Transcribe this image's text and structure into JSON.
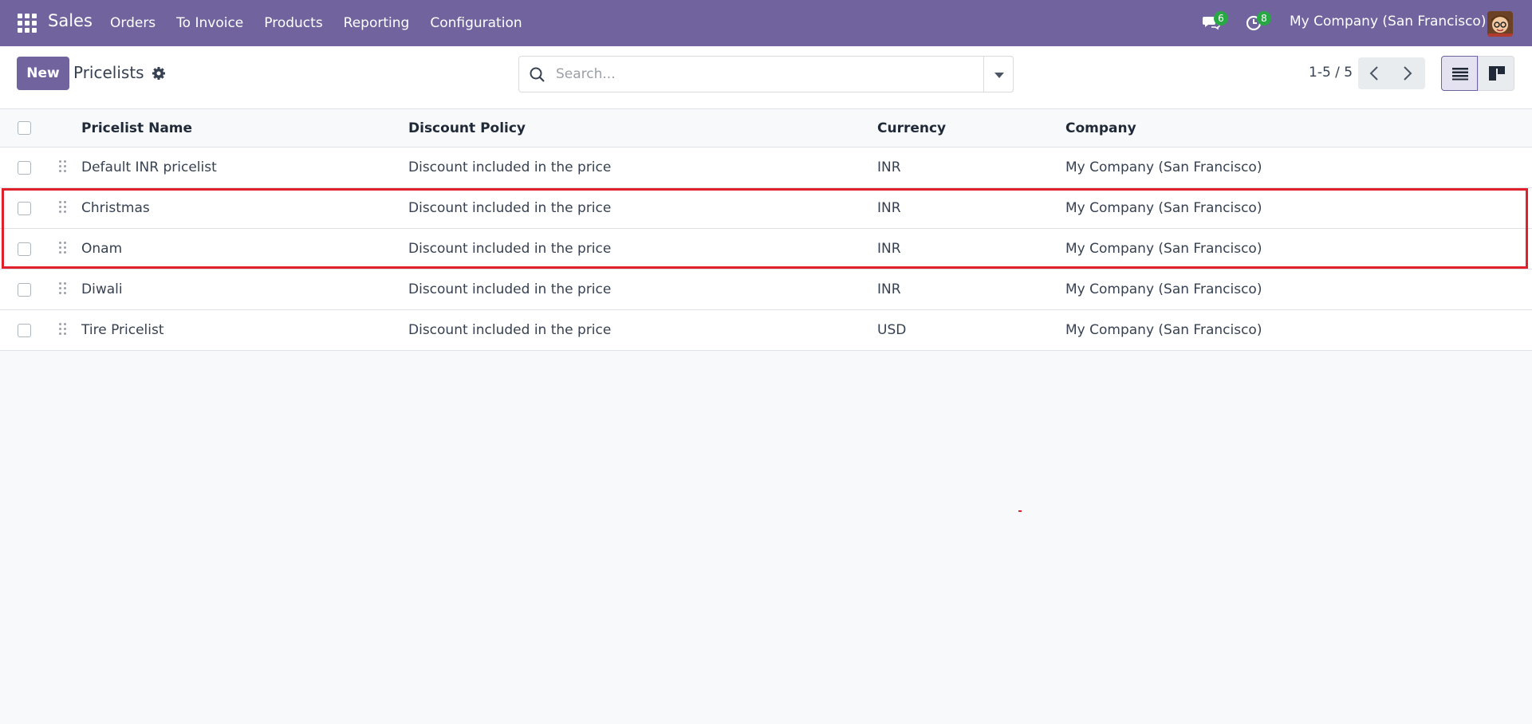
{
  "navbar": {
    "brand": "Sales",
    "menu": [
      "Orders",
      "To Invoice",
      "Products",
      "Reporting",
      "Configuration"
    ],
    "messages_badge": "6",
    "activities_badge": "8",
    "company": "My Company (San Francisco)"
  },
  "control": {
    "new_label": "New",
    "title": "Pricelists",
    "search_placeholder": "Search...",
    "pager": "1-5 / 5"
  },
  "table": {
    "headers": {
      "name": "Pricelist Name",
      "policy": "Discount Policy",
      "currency": "Currency",
      "company": "Company"
    },
    "rows": [
      {
        "name": "Default INR pricelist",
        "policy": "Discount included in the price",
        "currency": "INR",
        "company": "My Company (San Francisco)"
      },
      {
        "name": "Christmas",
        "policy": "Discount included in the price",
        "currency": "INR",
        "company": "My Company (San Francisco)"
      },
      {
        "name": "Onam",
        "policy": "Discount included in the price",
        "currency": "INR",
        "company": "My Company (San Francisco)"
      },
      {
        "name": "Diwali",
        "policy": "Discount included in the price",
        "currency": "INR",
        "company": "My Company (San Francisco)"
      },
      {
        "name": "Tire Pricelist",
        "policy": "Discount included in the price",
        "currency": "USD",
        "company": "My Company (San Francisco)"
      }
    ]
  },
  "colors": {
    "brand": "#71639e",
    "highlight": "#e0202a",
    "badge": "#28a745"
  }
}
